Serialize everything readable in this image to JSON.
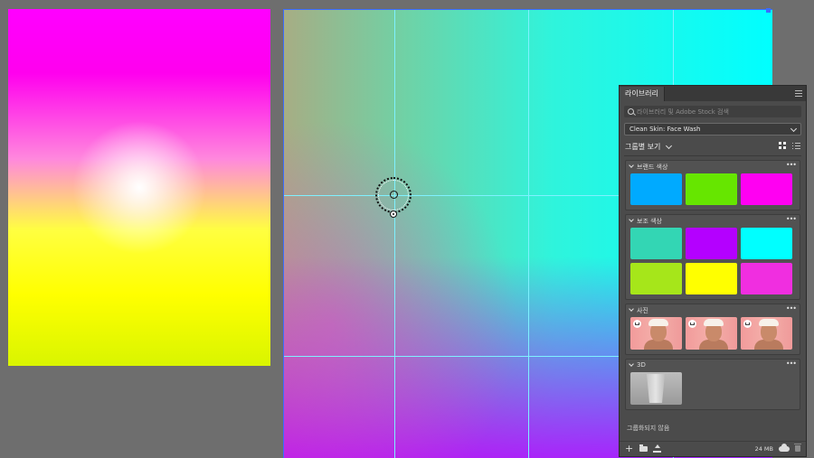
{
  "panel": {
    "tab_label": "라이브러리",
    "search_placeholder": "라이브러리 및 Adobe Stock 검색",
    "library_name": "Clean Skin: Face Wash",
    "group_by_label": "그룹별 보기",
    "ungrouped_label": "그룹화되지 않음",
    "storage_label": "24 MB",
    "sections": [
      {
        "title": "브랜드 색상",
        "colors": [
          "#00aaff",
          "#66e600",
          "#ff00f2"
        ]
      },
      {
        "title": "보조 색상",
        "colors": [
          "#33d6b4",
          "#b400ff",
          "#00ffff",
          "#a6e61a",
          "#ffff00",
          "#f02ee0"
        ]
      },
      {
        "title": "사진",
        "photo_count": 3
      },
      {
        "title": "3D",
        "model_count": 1
      }
    ]
  },
  "colors": {
    "panel_bg": "#4b4b4b",
    "guide": "#7ff1ff",
    "selection": "#3b6cff"
  }
}
